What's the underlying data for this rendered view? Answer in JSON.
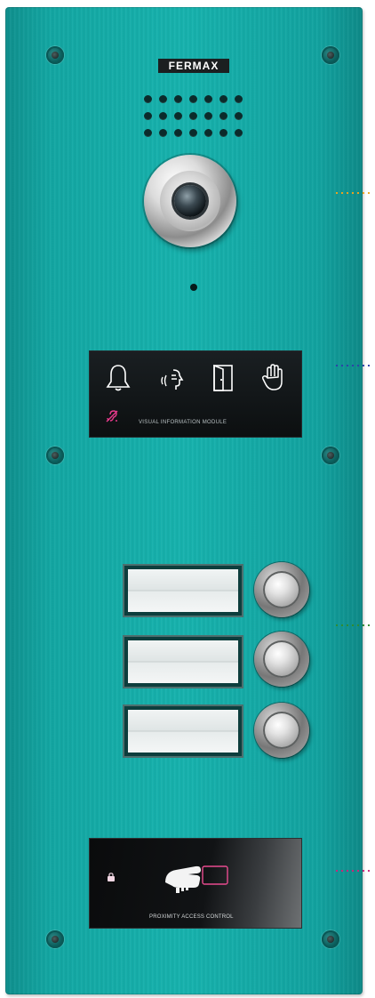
{
  "brand": {
    "logo_text": "FERMAX"
  },
  "vim_module": {
    "label": "VISUAL INFORMATION MODULE",
    "icons": [
      "bell-icon",
      "speaking-icon",
      "door-icon",
      "hand-stop-icon",
      "hearing-aid-icon"
    ]
  },
  "access_module": {
    "label": "PROXIMITY ACCESS CONTROL",
    "icons": [
      "lock-icon",
      "proximity-card-icon"
    ]
  },
  "call_buttons": {
    "count": 3
  },
  "indicator_colors": {
    "camera": "#f2a31b",
    "vim": "#2e3fa8",
    "buttons": "#2f8b2f",
    "access": "#d0217a"
  },
  "panel_color": "#17b2ad"
}
